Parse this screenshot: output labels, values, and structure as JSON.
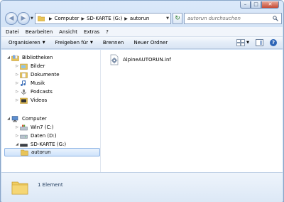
{
  "window": {
    "caption_buttons": {
      "minimize": "–",
      "maximize": "□",
      "close": "✕"
    }
  },
  "navigation": {
    "back_icon": "arrow-left",
    "forward_icon": "arrow-right",
    "breadcrumb": [
      "Computer",
      "SD-KARTE (G:)",
      "autorun"
    ],
    "search_placeholder": "autorun durchsuchen"
  },
  "menu": {
    "items": [
      "Datei",
      "Bearbeiten",
      "Ansicht",
      "Extras",
      "?"
    ]
  },
  "commands": {
    "organize": "Organisieren",
    "share": "Freigeben für",
    "burn": "Brennen",
    "new_folder": "Neuer Ordner"
  },
  "tree": {
    "libraries": {
      "label": "Bibliotheken",
      "children": [
        "Bilder",
        "Dokumente",
        "Musik",
        "Podcasts",
        "Videos"
      ]
    },
    "computer": {
      "label": "Computer",
      "drives": [
        "Win7 (C:)",
        "Daten (D:)",
        "SD-KARTE (G:)"
      ],
      "selected_folder": "autorun"
    }
  },
  "files": [
    {
      "name": "AlpineAUTORUN.inf",
      "icon": "settings-file"
    }
  ],
  "details": {
    "item_count": "1 Element"
  },
  "colors": {
    "folder": "#e8c458",
    "selection": "#cfe3fb",
    "frame": "#c4d7ef"
  }
}
